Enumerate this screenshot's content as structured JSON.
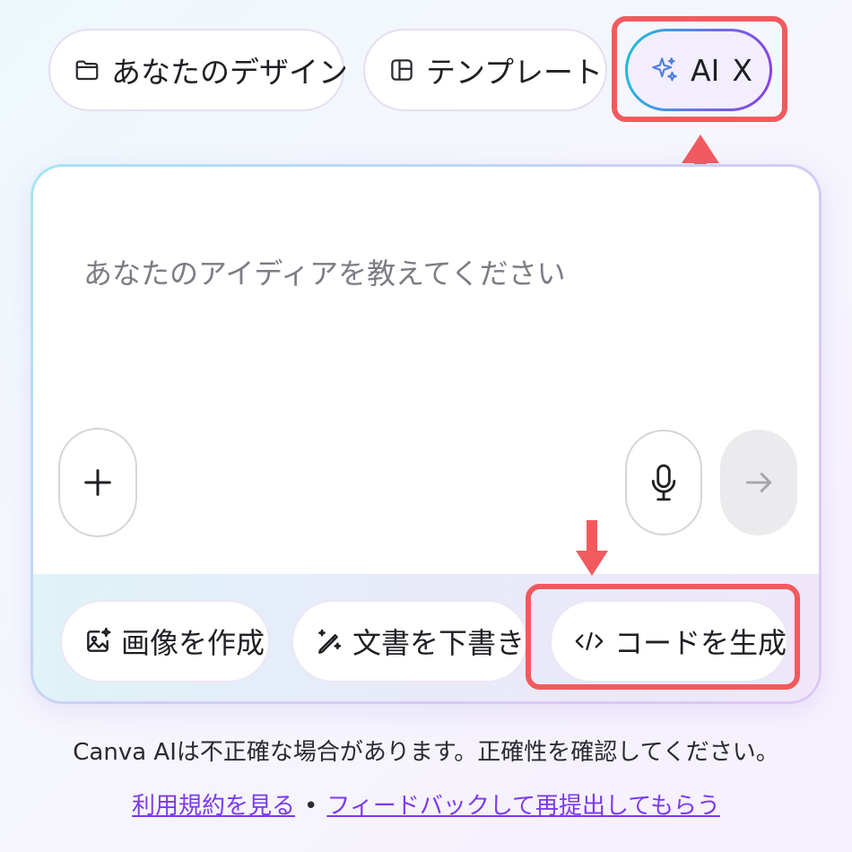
{
  "tabs": {
    "designs": "あなたのデザイン",
    "templates": "テンプレート",
    "ai": "AI",
    "ai_close": "X"
  },
  "prompt": {
    "placeholder": "あなたのアイディアを教えてください"
  },
  "actions": {
    "create_image": "画像を作成",
    "draft_document": "文書を下書き",
    "generate_code": "コードを生成"
  },
  "footer": {
    "disclaimer": "Canva AIは不正確な場合があります。正確性を確認してください。",
    "terms_link": "利用規約を見る",
    "separator": "•",
    "feedback_link": "フィードバックして再提出してもらう"
  },
  "colors": {
    "highlight_red": "#f25a5e",
    "link_purple": "#7c3aed",
    "ai_gradient_start": "#19c3d6",
    "ai_gradient_end": "#8a3fe0"
  },
  "icons": {
    "designs_tab": "folder-icon",
    "templates_tab": "template-layout-icon",
    "ai_tab": "sparkles-icon",
    "add": "plus-icon",
    "mic": "microphone-icon",
    "send": "arrow-right-icon",
    "create_image": "image-sparkle-icon",
    "draft_document": "pen-sparkle-icon",
    "generate_code": "code-icon"
  }
}
